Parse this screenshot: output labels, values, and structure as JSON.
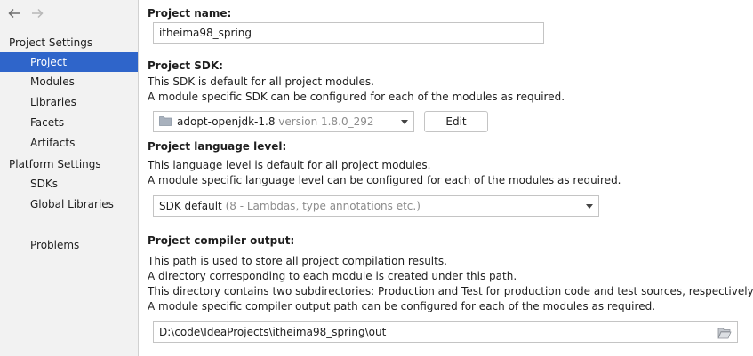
{
  "sidebar": {
    "back_icon": "arrow-left-icon",
    "forward_icon": "arrow-right-icon",
    "groups": [
      {
        "title": "Project Settings",
        "items": [
          {
            "label": "Project",
            "selected": true
          },
          {
            "label": "Modules",
            "selected": false
          },
          {
            "label": "Libraries",
            "selected": false
          },
          {
            "label": "Facets",
            "selected": false
          },
          {
            "label": "Artifacts",
            "selected": false
          }
        ]
      },
      {
        "title": "Platform Settings",
        "items": [
          {
            "label": "SDKs",
            "selected": false
          },
          {
            "label": "Global Libraries",
            "selected": false
          }
        ]
      }
    ],
    "problems_label": "Problems",
    "selected_color": "#2f65ca"
  },
  "project_name": {
    "label": "Project name:",
    "value": "itheima98_spring"
  },
  "project_sdk": {
    "label": "Project SDK:",
    "desc1": "This SDK is default for all project modules.",
    "desc2": "A module specific SDK can be configured for each of the modules as required.",
    "sdk_name": "adopt-openjdk-1.8",
    "sdk_version": "version 1.8.0_292",
    "edit_label": "Edit"
  },
  "language_level": {
    "label": "Project language level:",
    "desc1": "This language level is default for all project modules.",
    "desc2": "A module specific language level can be configured for each of the modules as required.",
    "value": "SDK default",
    "hint": "(8 - Lambdas, type annotations etc.)"
  },
  "compiler_output": {
    "label": "Project compiler output:",
    "desc1": "This path is used to store all project compilation results.",
    "desc2": "A directory corresponding to each module is created under this path.",
    "desc3": "This directory contains two subdirectories: Production and Test for production code and test sources, respectively.",
    "desc4": "A module specific compiler output path can be configured for each of the modules as required.",
    "path": "D:\\code\\IdeaProjects\\itheima98_spring\\out",
    "browse_icon": "folder-open-icon"
  }
}
